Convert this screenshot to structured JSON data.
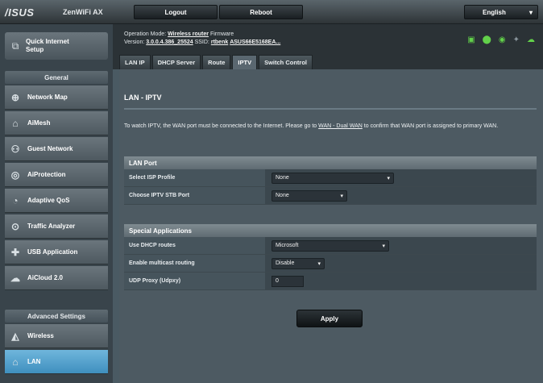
{
  "topbar": {
    "brand": "/ISUS",
    "model": "ZenWiFi AX",
    "logout_label": "Logout",
    "reboot_label": "Reboot",
    "language": "English"
  },
  "sidebar": {
    "quick_setup": "Quick Internet\nSetup",
    "general_header": "General",
    "general_items": [
      {
        "label": "Network Map",
        "icon": "network-map-icon"
      },
      {
        "label": "AiMesh",
        "icon": "aimesh-icon"
      },
      {
        "label": "Guest Network",
        "icon": "guest-network-icon"
      },
      {
        "label": "AiProtection",
        "icon": "aiprotection-icon"
      },
      {
        "label": "Adaptive QoS",
        "icon": "qos-icon"
      },
      {
        "label": "Traffic Analyzer",
        "icon": "traffic-analyzer-icon"
      },
      {
        "label": "USB Application",
        "icon": "usb-icon"
      },
      {
        "label": "AiCloud 2.0",
        "icon": "cloud-icon"
      }
    ],
    "advanced_header": "Advanced Settings",
    "advanced_items": [
      {
        "label": "Wireless",
        "icon": "wireless-icon"
      },
      {
        "label": "LAN",
        "icon": "lan-icon",
        "active": true
      }
    ]
  },
  "info": {
    "opmode_label": "Operation Mode:",
    "opmode_value": "Wireless router",
    "firmware_label": "Firmware",
    "version_label": "Version:",
    "version_value": "3.0.0.4.386_25524",
    "ssid_label": "SSID:",
    "ssid_value": "rtbenk",
    "ssid_value2": "ASUS66E5168EA..."
  },
  "tabs": [
    {
      "label": "LAN IP",
      "active": false
    },
    {
      "label": "DHCP Server",
      "active": false
    },
    {
      "label": "Route",
      "active": false
    },
    {
      "label": "IPTV",
      "active": true
    },
    {
      "label": "Switch Control",
      "active": false
    }
  ],
  "content": {
    "title": "LAN - IPTV",
    "desc_pre": "To watch IPTV, the WAN port must be connected to the Internet. Please go to ",
    "desc_link": "WAN - Dual WAN",
    "desc_post": " to confirm that WAN port is assigned to primary WAN.",
    "lan_port_header": "LAN Port",
    "lan_rows": [
      {
        "label": "Select ISP Profile",
        "value": "None",
        "type": "select"
      },
      {
        "label": "Choose IPTV STB Port",
        "value": "None",
        "type": "select"
      }
    ],
    "special_header": "Special Applications",
    "special_rows": [
      {
        "label": "Use DHCP routes",
        "value": "Microsoft",
        "type": "select"
      },
      {
        "label": "Enable multicast routing",
        "value": "Disable",
        "type": "select"
      },
      {
        "label": "UDP Proxy (Udpxy)",
        "value": "0",
        "type": "input"
      }
    ],
    "apply_label": "Apply"
  }
}
